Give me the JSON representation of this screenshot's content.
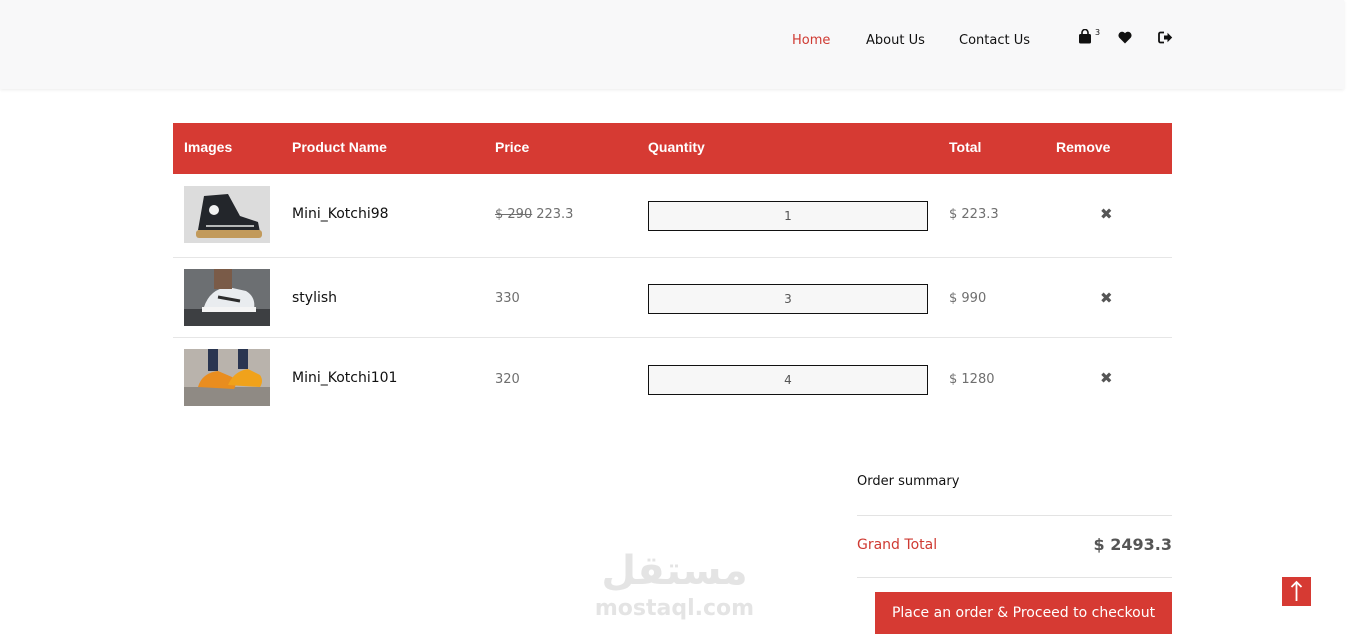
{
  "nav": {
    "links": [
      "Home",
      "About Us",
      "Contact Us"
    ],
    "active": "Home",
    "cart_count": "3",
    "icons": [
      "shopping-bag-icon",
      "heart-icon",
      "logout-icon"
    ]
  },
  "table": {
    "headers": [
      "Images",
      "Product Name",
      "Price",
      "Quantity",
      "Total",
      "Remove"
    ],
    "rows": [
      {
        "image": "sneaker-hightop-black",
        "name": "Mini_Kotchi98",
        "old_price": "$ 290",
        "price": "223.3",
        "quantity": "1",
        "total": "$ 223.3",
        "remove": "✖"
      },
      {
        "image": "sneaker-white",
        "name": "stylish",
        "old_price": "",
        "price": "330",
        "quantity": "3",
        "total": "$ 990",
        "remove": "✖"
      },
      {
        "image": "sneaker-orange",
        "name": "Mini_Kotchi101",
        "old_price": "",
        "price": "320",
        "quantity": "4",
        "total": "$ 1280",
        "remove": "✖"
      }
    ]
  },
  "summary": {
    "title": "Order summary",
    "grand_total_label": "Grand Total",
    "grand_total_value": "$ 2493.3",
    "checkout_label": "Place an order & Proceed to checkout"
  },
  "watermark": {
    "arabic": "مستقل",
    "latin": "mostaql.com"
  },
  "colors": {
    "accent": "#d63a33",
    "navbar_bg": "#f8f8f9",
    "muted_text": "#6f6f6f"
  }
}
